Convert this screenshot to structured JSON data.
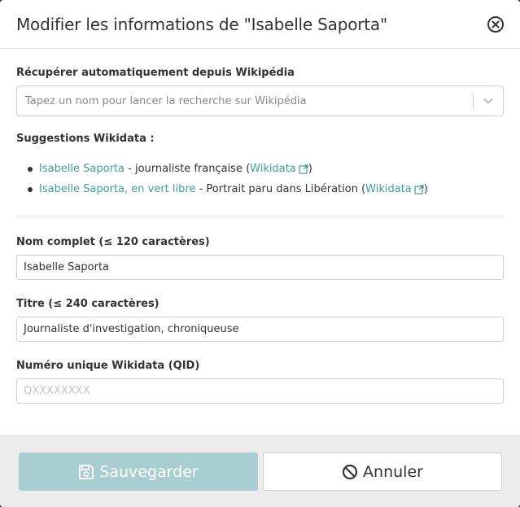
{
  "modal": {
    "title": "Modifier les informations de \"Isabelle Saporta\"",
    "close_icon": "close-circle-icon"
  },
  "wikipedia": {
    "label": "Récupérer automatiquement depuis Wikipédia",
    "placeholder": "Tapez un nom pour lancer la recherche sur Wikipédia"
  },
  "suggestions": {
    "title": "Suggestions Wikidata :",
    "items": [
      {
        "name": "Isabelle Saporta",
        "desc": " - journaliste française (",
        "link": "Wikidata",
        "close": ")"
      },
      {
        "name": "Isabelle Saporta, en vert libre",
        "desc": " - Portrait paru dans Libération (",
        "link": "Wikidata",
        "close": ")"
      }
    ]
  },
  "fields": {
    "full_name": {
      "label": "Nom complet (≤ 120 caractères)",
      "value": "Isabelle Saporta"
    },
    "title": {
      "label": "Titre (≤ 240 caractères)",
      "value": "Journaliste d'investigation, chroniqueuse"
    },
    "qid": {
      "label": "Numéro unique Wikidata (QID)",
      "placeholder": "QXXXXXXXX"
    }
  },
  "footer": {
    "save_label": "Sauvegarder",
    "cancel_label": "Annuler"
  },
  "colors": {
    "link": "#3e9e9a",
    "save_button": "#a9cdd0"
  }
}
